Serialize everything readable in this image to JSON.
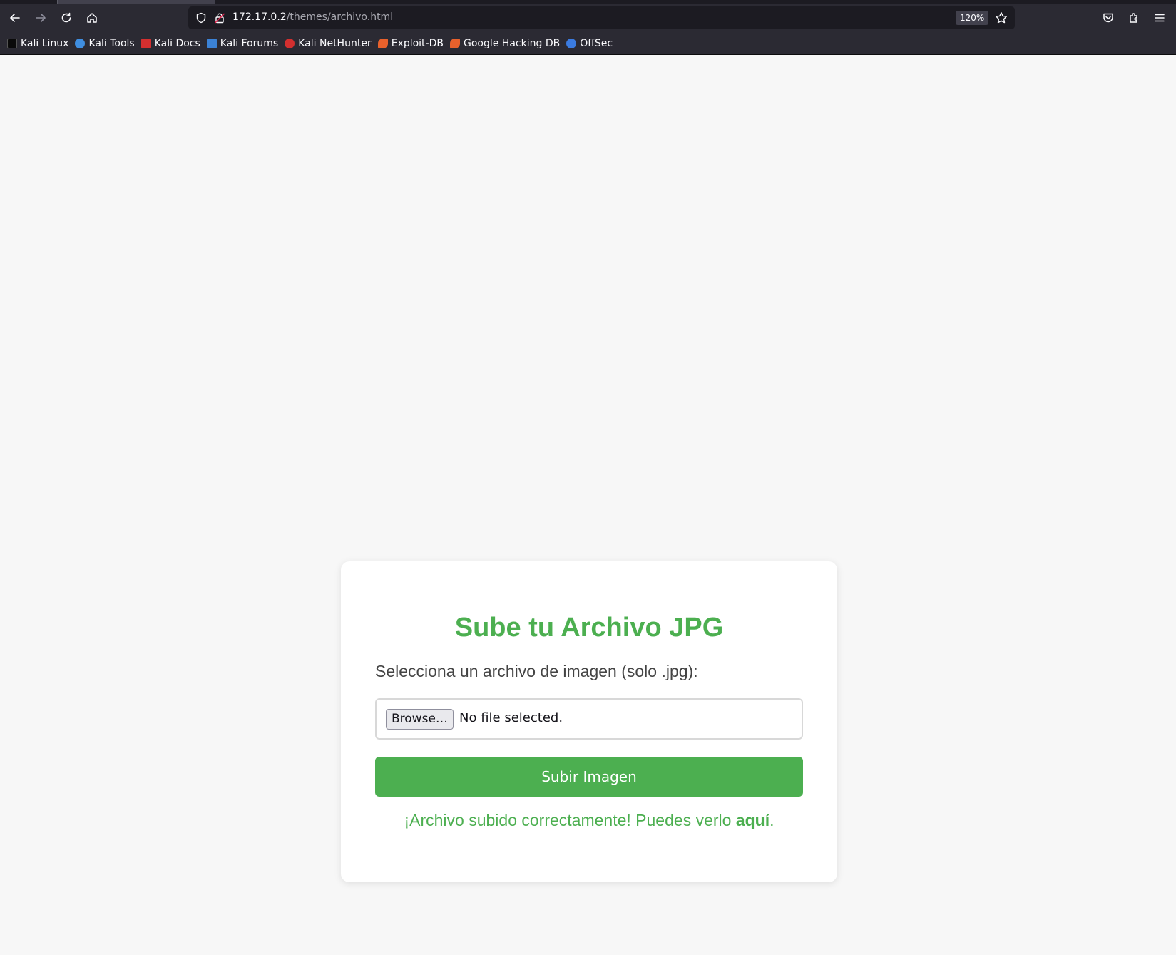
{
  "browser": {
    "url_host": "172.17.0.2",
    "url_path": "/themes/archivo.html",
    "zoom": "120%",
    "icons": {
      "back": "back-arrow-icon",
      "forward": "forward-arrow-icon",
      "reload": "reload-icon",
      "home": "home-icon",
      "shield": "tracking-protection-icon",
      "lock": "insecure-lock-icon",
      "star": "bookmark-star-icon",
      "pocket": "pocket-icon",
      "extensions": "extensions-icon",
      "menu": "hamburger-menu-icon"
    },
    "bookmarks": [
      {
        "label": "Kali Linux",
        "color": "#2d2d2d"
      },
      {
        "label": "Kali Tools",
        "color": "#3f8ee0"
      },
      {
        "label": "Kali Docs",
        "color": "#d32f2f"
      },
      {
        "label": "Kali Forums",
        "color": "#3b82d6"
      },
      {
        "label": "Kali NetHunter",
        "color": "#d32f2f"
      },
      {
        "label": "Exploit-DB",
        "color": "#e8612c"
      },
      {
        "label": "Google Hacking DB",
        "color": "#e8612c"
      },
      {
        "label": "OffSec",
        "color": "#3b7be0"
      }
    ]
  },
  "page": {
    "title": "Sube tu Archivo JPG",
    "field_label": "Selecciona un archivo de imagen (solo .jpg):",
    "browse_label": "Browse…",
    "file_status": "No file selected.",
    "submit_label": "Subir Imagen",
    "success_text": "¡Archivo subido correctamente! Puedes verlo ",
    "success_link": "aquí",
    "success_end": ".",
    "accent_color": "#4caf50"
  }
}
